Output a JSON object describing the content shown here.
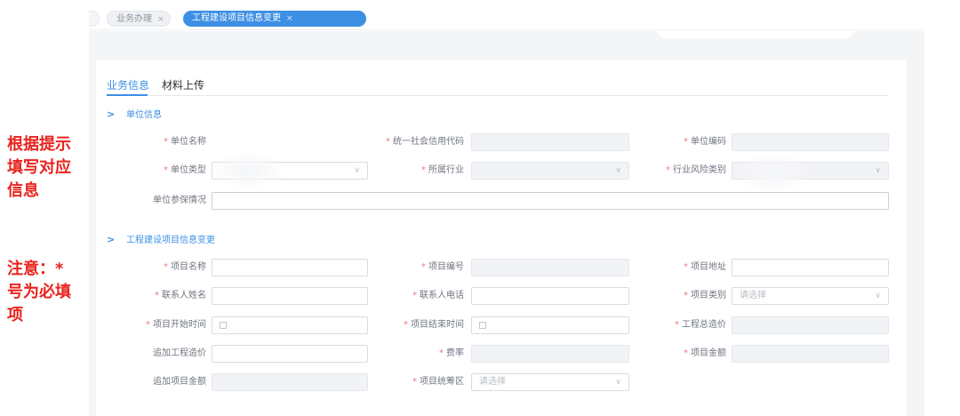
{
  "annotation": {
    "line1": "根据提示填写对应信息",
    "line2": "注意：*号为必填项"
  },
  "tabs": [
    {
      "label": "业务办理",
      "active": false
    },
    {
      "label": "工程建设项目信息变更",
      "active": true
    }
  ],
  "subtabs": [
    {
      "label": "业务信息",
      "active": true
    },
    {
      "label": "材料上传",
      "active": false
    }
  ],
  "sections": {
    "unit": "单位信息",
    "project": "工程建设项目信息变更"
  },
  "unit_fields": {
    "unit_name": "单位名称",
    "credit_code": "统一社会信用代码",
    "unit_code": "单位编码",
    "unit_type": "单位类型",
    "industry": "所属行业",
    "risk_category": "行业风险类别",
    "insurance_status": "单位参保情况"
  },
  "project_fields": {
    "project_name": "项目名称",
    "project_number": "项目编号",
    "project_address": "项目地址",
    "contact_name": "联系人姓名",
    "contact_phone": "联系人电话",
    "project_category": "项目类别",
    "start_time": "项目开始时间",
    "end_time": "项目结束时间",
    "total_cost": "工程总造价",
    "added_cost": "追加工程造价",
    "rate": "费率",
    "project_amount": "项目金额",
    "added_amount": "追加项目金额",
    "planning_area": "项目统筹区"
  },
  "placeholders": {
    "select": "请选择"
  },
  "colors": {
    "accent": "#3d8fe4",
    "annotation": "#e8231e",
    "required": "#f07878"
  }
}
